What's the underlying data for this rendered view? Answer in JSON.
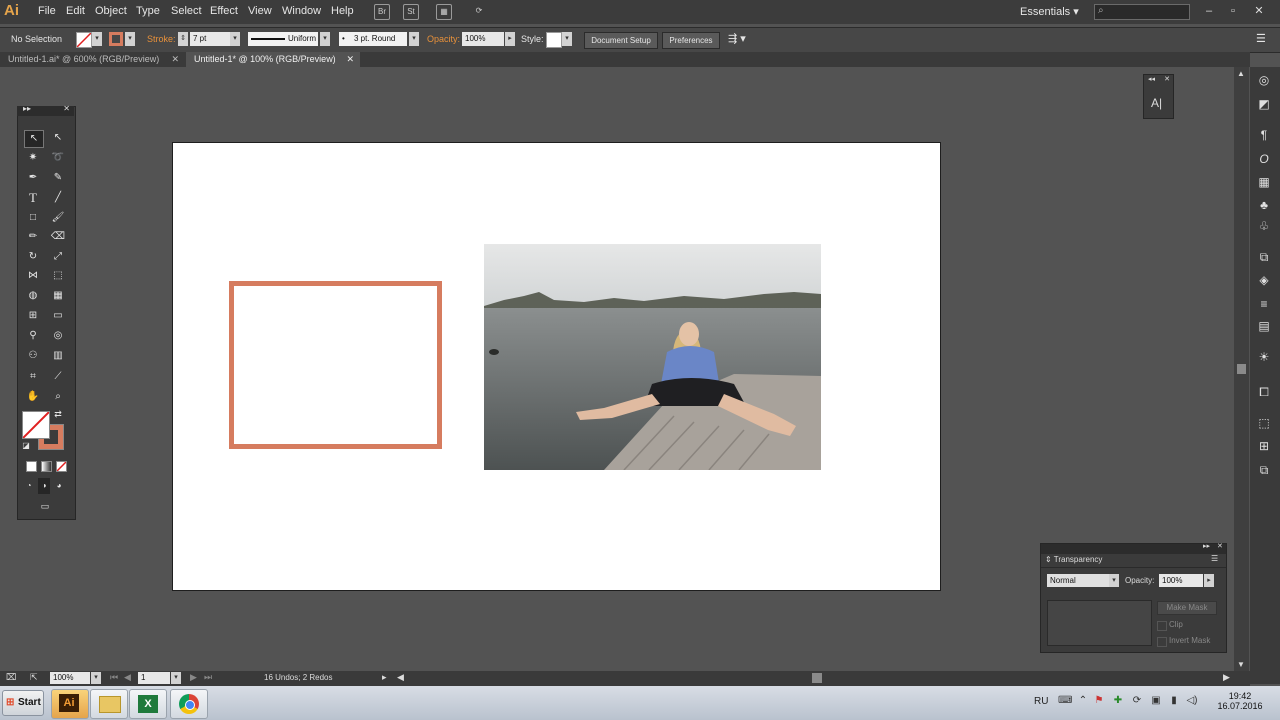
{
  "app": {
    "logo": "Ai",
    "workspace": "Essentials"
  },
  "menus": [
    "File",
    "Edit",
    "Object",
    "Type",
    "Select",
    "Effect",
    "View",
    "Window",
    "Help"
  ],
  "control_bar": {
    "selection": "No Selection",
    "stroke_label": "Stroke:",
    "stroke_value": "7 pt",
    "profile": "Uniform",
    "brush": "3 pt. Round",
    "opacity_label": "Opacity:",
    "opacity_value": "100%",
    "style_label": "Style:",
    "document_setup": "Document Setup",
    "preferences": "Preferences"
  },
  "tabs": [
    {
      "label": "Untitled-1.ai* @ 600% (RGB/Preview)",
      "active": false
    },
    {
      "label": "Untitled-1* @ 100% (RGB/Preview)",
      "active": true
    }
  ],
  "status_bar": {
    "zoom": "100%",
    "artboard": "1",
    "undo_info": "16 Undos; 2 Redos"
  },
  "transparency_panel": {
    "title": "Transparency",
    "blend_mode": "Normal",
    "opacity_label": "Opacity:",
    "opacity_value": "100%",
    "make_mask": "Make Mask",
    "clip": "Clip",
    "invert_mask": "Invert Mask"
  },
  "char_panel": {
    "label": "A|"
  },
  "artwork": {
    "rect_stroke_color": "#d67c5f"
  },
  "taskbar": {
    "start_label": "Start",
    "language": "RU",
    "time": "19:42",
    "date": "16.07.2016"
  }
}
